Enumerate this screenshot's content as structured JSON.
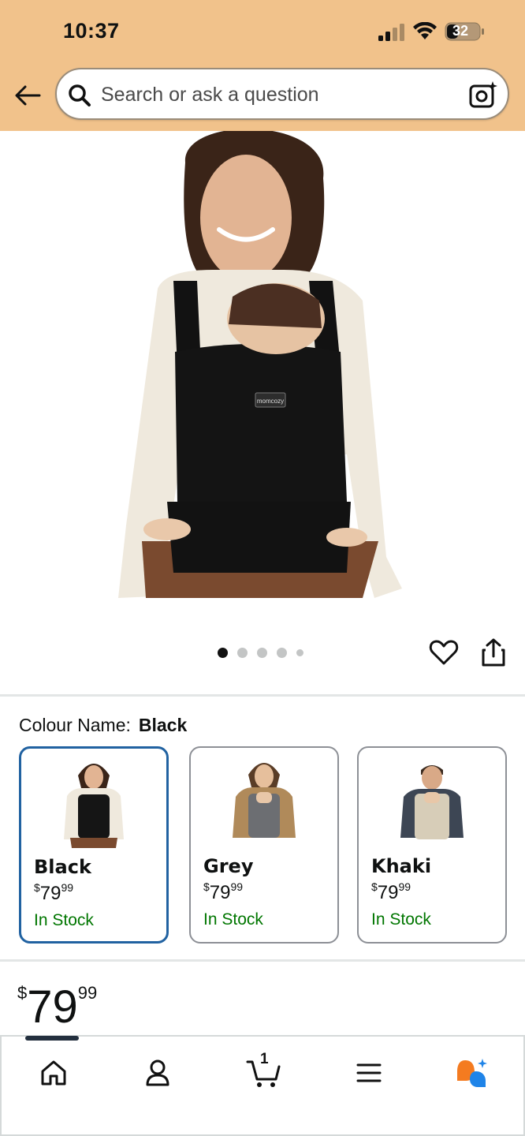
{
  "status_bar": {
    "time": "10:37",
    "battery": "32"
  },
  "search": {
    "placeholder": "Search or ask a question"
  },
  "carousel": {
    "image_count": 5,
    "active_index": 0
  },
  "colour": {
    "label": "Colour Name:",
    "selected": "Black",
    "options": [
      {
        "name": "Black",
        "currency": "$",
        "price_whole": "79",
        "price_fraction": "99",
        "stock": "In Stock"
      },
      {
        "name": "Grey",
        "currency": "$",
        "price_whole": "79",
        "price_fraction": "99",
        "stock": "In Stock"
      },
      {
        "name": "Khaki",
        "currency": "$",
        "price_whole": "79",
        "price_fraction": "99",
        "stock": "In Stock"
      }
    ]
  },
  "price": {
    "currency": "$",
    "whole": "79",
    "fraction": "99"
  },
  "product": {
    "brand_label": "momcozy"
  },
  "cart": {
    "count": "1"
  },
  "icons": {
    "back": "back-arrow-icon",
    "search": "search-icon",
    "camera": "camera-search-icon",
    "heart": "heart-icon",
    "share": "share-icon",
    "home": "home-icon",
    "account": "account-icon",
    "cart": "cart-icon",
    "menu": "menu-icon",
    "rufus": "rufus-assistant-icon"
  },
  "colors": {
    "header": "#f1c28b",
    "stock": "#007600",
    "selected_border": "#2162a1"
  }
}
